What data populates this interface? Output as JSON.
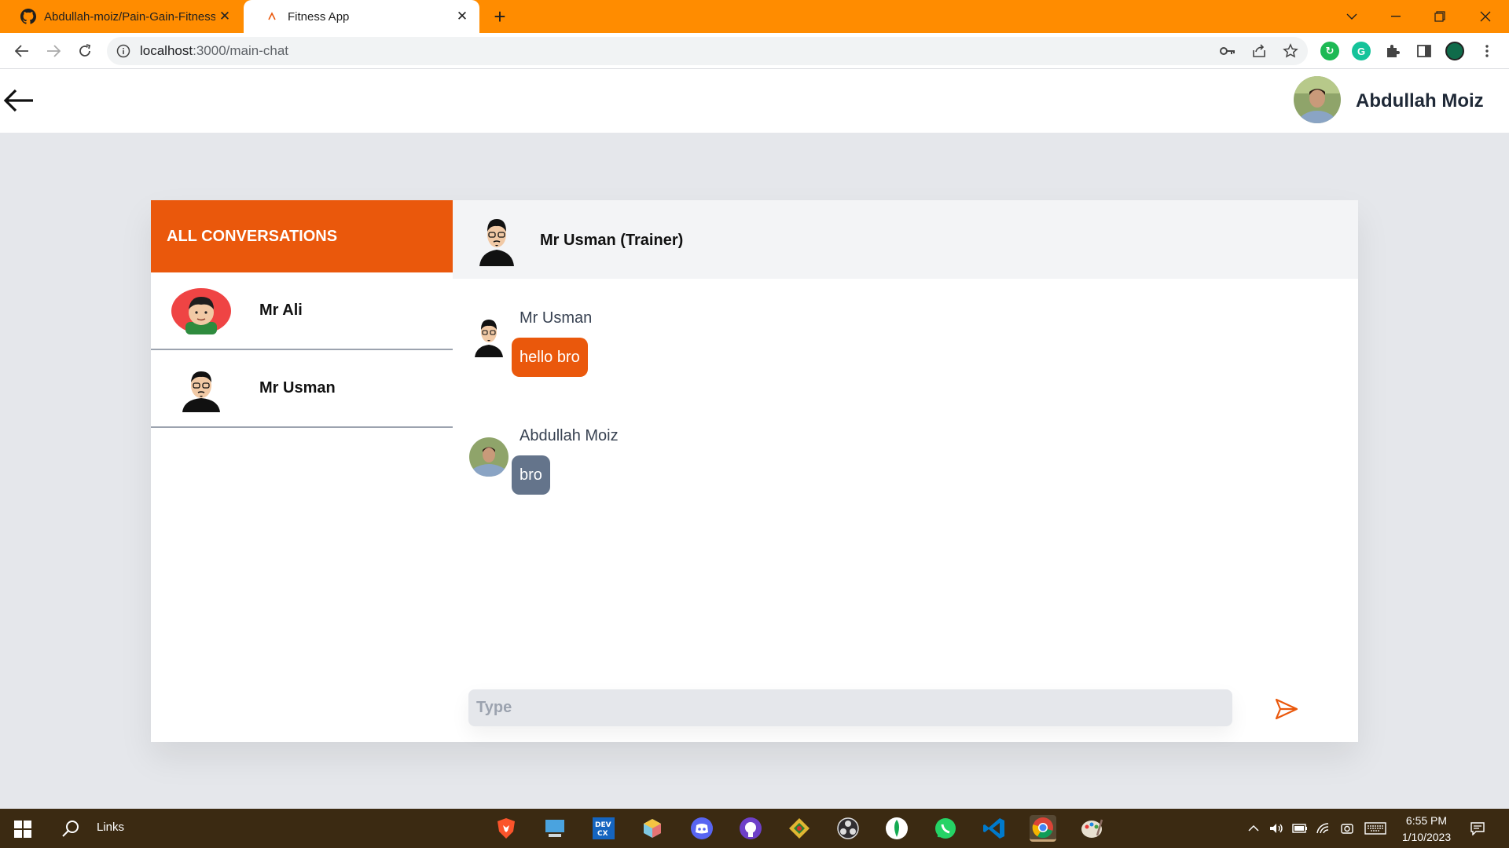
{
  "browser": {
    "tabs": [
      {
        "title": "Abdullah-moiz/Pain-Gain-Fitness",
        "icon": "github-icon",
        "active": false
      },
      {
        "title": "Fitness App",
        "icon": "fitness-favicon",
        "active": true
      }
    ],
    "url_host": "localhost",
    "url_path": ":3000/main-chat",
    "accent_color": "#ff8c00"
  },
  "header": {
    "user_name": "Abdullah Moiz"
  },
  "sidebar": {
    "title": "ALL CONVERSATIONS",
    "conversations": [
      {
        "name": "Mr Ali",
        "avatar": "cartoon-boy-avatar"
      },
      {
        "name": "Mr Usman",
        "avatar": "cartoon-man-glasses-avatar"
      }
    ]
  },
  "chat": {
    "contact_name": "Mr Usman (Trainer)",
    "messages": [
      {
        "sender": "Mr Usman",
        "text": "hello bro",
        "color": "#ea580c"
      },
      {
        "sender": "Abdullah Moiz",
        "text": "bro",
        "color": "#64748b"
      }
    ],
    "input_placeholder": "Type",
    "input_value": ""
  },
  "taskbar": {
    "search_label": "Links",
    "time": "6:55 PM",
    "date": "1/10/2023",
    "apps": [
      "brave-icon",
      "computer-icon",
      "devcx-icon",
      "cube-icon",
      "discord-icon",
      "github-icon",
      "gitkraken-icon",
      "obs-icon",
      "mongodb-icon",
      "whatsapp-icon",
      "vscode-icon",
      "chrome-icon",
      "paint-icon"
    ]
  },
  "colors": {
    "brand": "#ea580c",
    "page_bg": "#e5e7eb",
    "muted_bubble": "#64748b"
  }
}
